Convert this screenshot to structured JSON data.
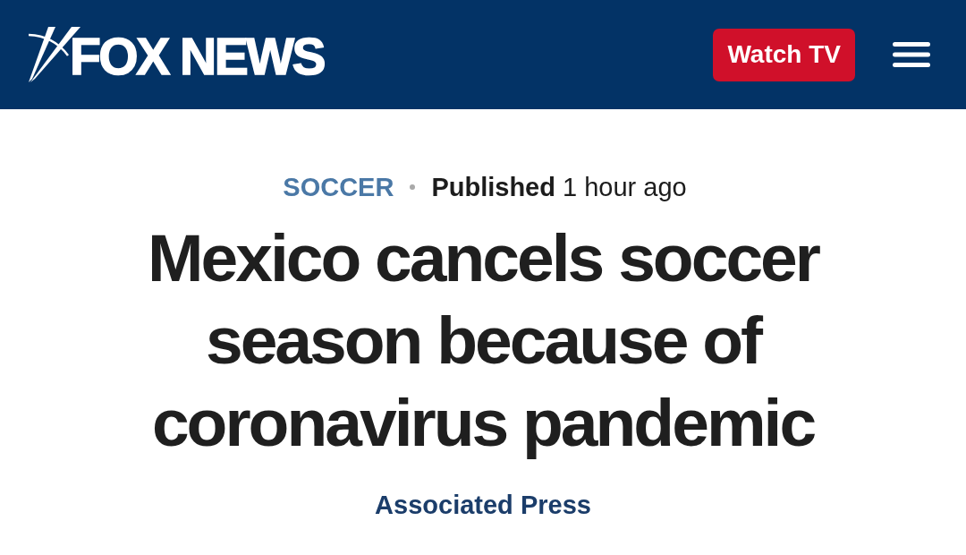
{
  "header": {
    "logo": {
      "text": "FOX NEWS"
    },
    "watch_button": {
      "label": "Watch TV"
    }
  },
  "article": {
    "category": "SOCCER",
    "published": "**Published** 1 hour ago",
    "headline": "Mexico cancels soccer season because of coronavirus pandemic",
    "byline": "Associated Press"
  }
}
